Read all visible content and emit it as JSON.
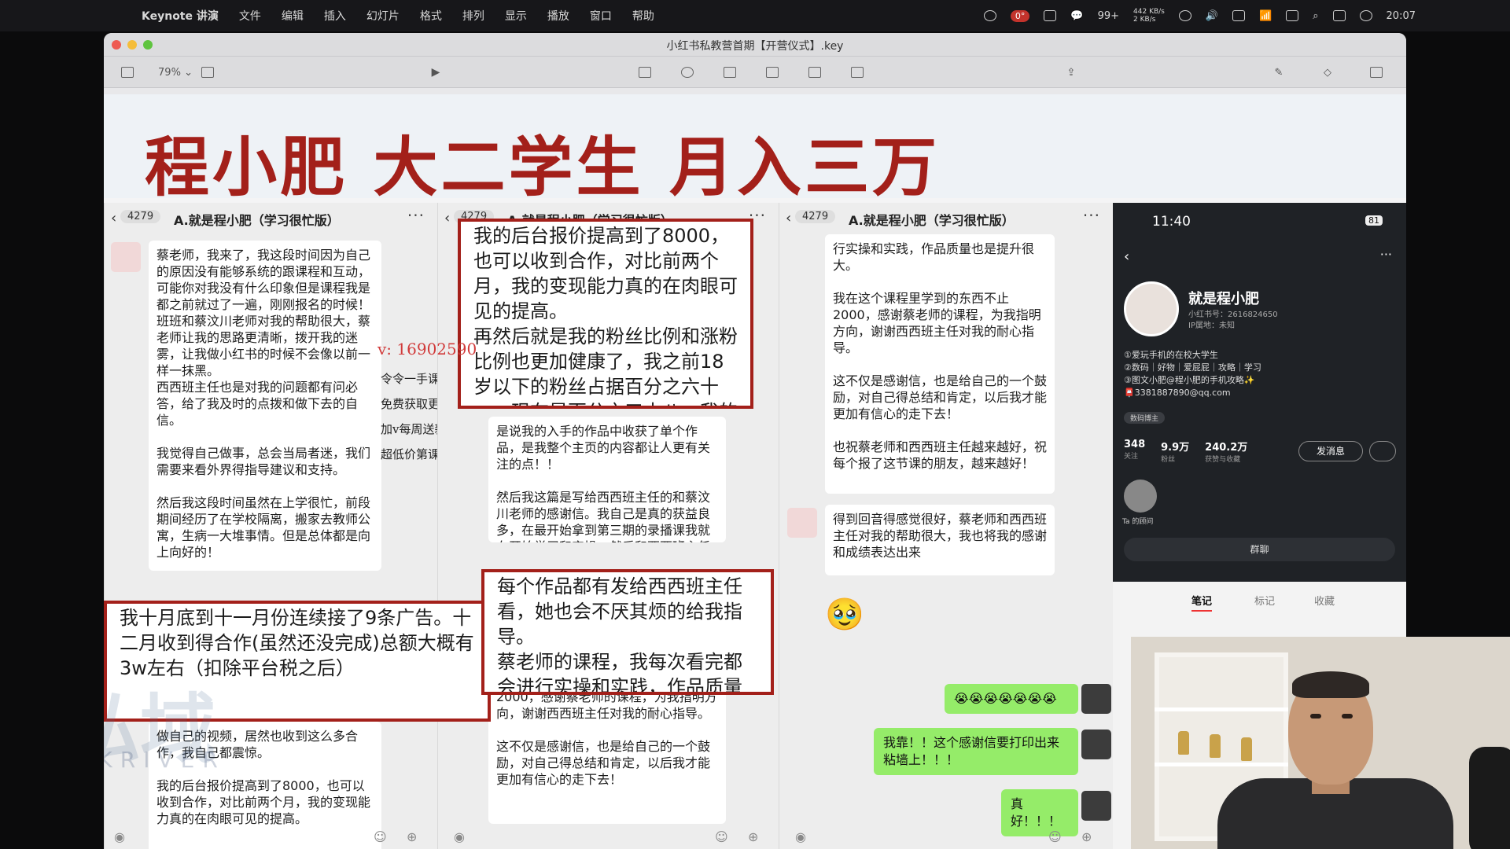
{
  "menubar": {
    "app": "Keynote 讲演",
    "items": [
      "文件",
      "编辑",
      "插入",
      "幻灯片",
      "格式",
      "排列",
      "显示",
      "播放",
      "窗口",
      "帮助"
    ],
    "wechat_badge": "99+",
    "network": "442 KB/s\n2 KB/s",
    "temp": "0°",
    "clock": "20:07"
  },
  "window": {
    "title": "小红书私教营首期【开营仪式】.key",
    "zoom": "79%"
  },
  "slide": {
    "headline": "程小肥 大二学生 月入三万",
    "watermark_contact": "v: 16902590",
    "overlay_lines": [
      "令令一手课源",
      "免费获取更新内容",
      "加v每周送新课",
      "超低价第课"
    ],
    "logo_watermark": "私域",
    "logo_watermark2": "MIKRIVER"
  },
  "chat1": {
    "count": "4279",
    "name": "A.就是程小肥（学习很忙版）",
    "bubble_top": "蔡老师，我来了，我这段时间因为自己的原因没有能够系统的跟课程和互动，可能你对我没有什么印象但是课程我是都之前就过了一遍，刚刚报名的时候！\n班班和蔡汶川老师对我的帮助很大，蔡老师让我的思路更清晰，拨开我的迷雾，让我做小红书的时候不会像以前一样一抹黑。\n西西班主任也是对我的问题都有问必答，给了我及时的点拨和做下去的自信。\n\n我觉得自己做事，总会当局者迷，我们需要来看外界得指导建议和支持。\n\n然后我这段时间虽然在上学很忙，前段期间经历了在学校隔离，搬家去教师公寓，生病一大堆事情。但是总体都是向上向好的！",
    "bubble_bottom": "做自己的视频，居然也收到这么多合作，我自己都震惊。\n\n我的后台报价提高到了8000，也可以收到合作，对比前两个月，我的变现能力真的在肉眼可见的提高。"
  },
  "chat2": {
    "count": "4279",
    "name": "A.就是程小肥（学习很忙版）",
    "bubble_mid": "是说我的入手的作品中收获了单个作品，是我整个主页的内容都让人更有关注的点！！\n\n然后我这篇是写给西西班主任的和蔡汶川老师的感谢信。我自己是真的获益良多，在最开始拿到第三期的录播课我就在开始学习和实操，然后和西西班主任进行交流。",
    "bubble_bottom": "2000，感谢蔡老师的课程，为我指明方向，谢谢西西班主任对我的耐心指导。\n\n这不仅是感谢信，也是给自己的一个鼓励，对自己得总结和肯定，以后我才能更加有信心的走下去！"
  },
  "chat3": {
    "count": "4279",
    "name": "A.就是程小肥（学习很忙版）",
    "bubble_top": "行实操和实践，作品质量也是提升很大。\n\n我在这个课程里学到的东西不止2000，感谢蔡老师的课程，为我指明方向，谢谢西西班主任对我的耐心指导。\n\n这不仅是感谢信，也是给自己的一个鼓励，对自己得总结和肯定，以后我才能更加有信心的走下去！\n\n也祝蔡老师和西西班主任越来越好，祝每个报了这节课的朋友，越来越好！",
    "bubble_reply": "得到回音得感觉很好，蔡老师和西西班主任对我的帮助很大，我也将我的感谢和成绩表达出来",
    "green_emojis": "😭😭😭😭😭😭😭",
    "green_1": "我靠！！这个感谢信要打印出来粘墙上！！！",
    "green_2": "真好！！！"
  },
  "callouts": {
    "top": "我的后台报价提高到了8000，也可以收到合作，对比前两个月，我的变现能力真的在肉眼可见的提高。\n再然后就是我的粉丝比例和涨粉比例也更加健康了，我之前18岁以下的粉丝占据百分之六十一。现在是百分之五十八。我的作品受众年龄",
    "left": "我十月底到十一月份连续接了9条广告。十二月收到得合作(虽然还没完成)总额大概有3w左右（扣除平台税之后）",
    "middle": "每个作品都有发给西西班主任看，她也会不厌其烦的给我指导。\n蔡老师的课程，我每次看完都会进行实操和实践，作品质量也是提升很大"
  },
  "phone": {
    "time": "11:40",
    "battery": "81",
    "name": "就是程小肥",
    "sub": "小红书号：2616824650\nIP属地：未知",
    "bio": "①爱玩手机的在校大学生\n②数码｜好物｜爱屁屁｜攻略｜学习\n③图文小肥@程小肥的手机攻略✨\n📮3381887890@qq.com",
    "tag": "数码博主",
    "stats": [
      {
        "value": "348",
        "label": "关注"
      },
      {
        "value": "9.9万",
        "label": "粉丝"
      },
      {
        "value": "240.2万",
        "label": "获赞与收藏"
      }
    ],
    "message_btn": "发消息",
    "mini_label": "Ta 的顾问",
    "group_btn": "群聊",
    "tabs": [
      "笔记",
      "标记",
      "收藏"
    ]
  }
}
